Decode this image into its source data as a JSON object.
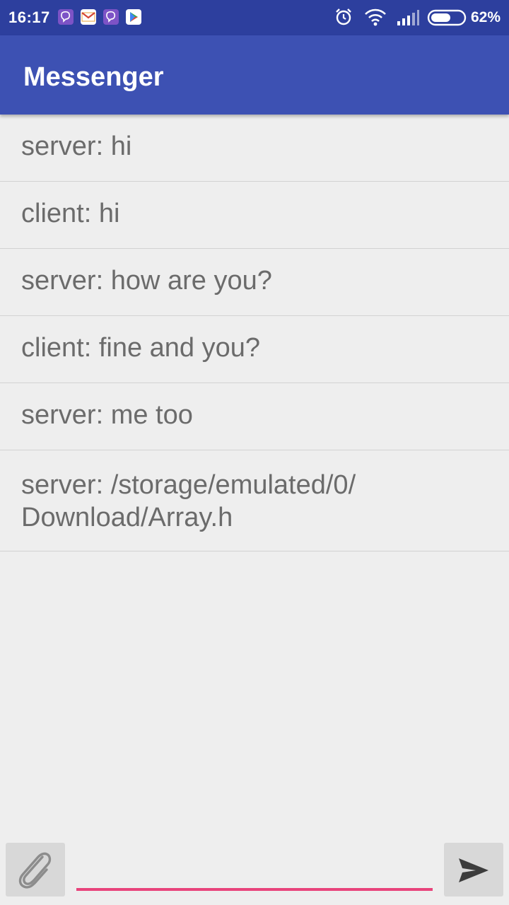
{
  "status_bar": {
    "time": "16:17",
    "battery_percent": "62%",
    "battery_level": 0.62,
    "notification_icons": [
      "viber-icon",
      "gmail-icon",
      "viber-icon",
      "play-store-icon"
    ],
    "system_icons": [
      "alarm-icon",
      "wifi-icon",
      "signal-icon",
      "battery-icon"
    ]
  },
  "app_bar": {
    "title": "Messenger",
    "color": "#3d51b3"
  },
  "messages": [
    {
      "text": "server: hi"
    },
    {
      "text": "client: hi"
    },
    {
      "text": "server: how are you?"
    },
    {
      "text": "client: fine and you?"
    },
    {
      "text": "server: me too"
    },
    {
      "text": "server: /storage/emulated/0/\nDownload/Array.h"
    }
  ],
  "composer": {
    "input_value": "",
    "attach_icon": "paperclip-icon",
    "send_icon": "send-icon",
    "accent_color": "#e8437b"
  }
}
